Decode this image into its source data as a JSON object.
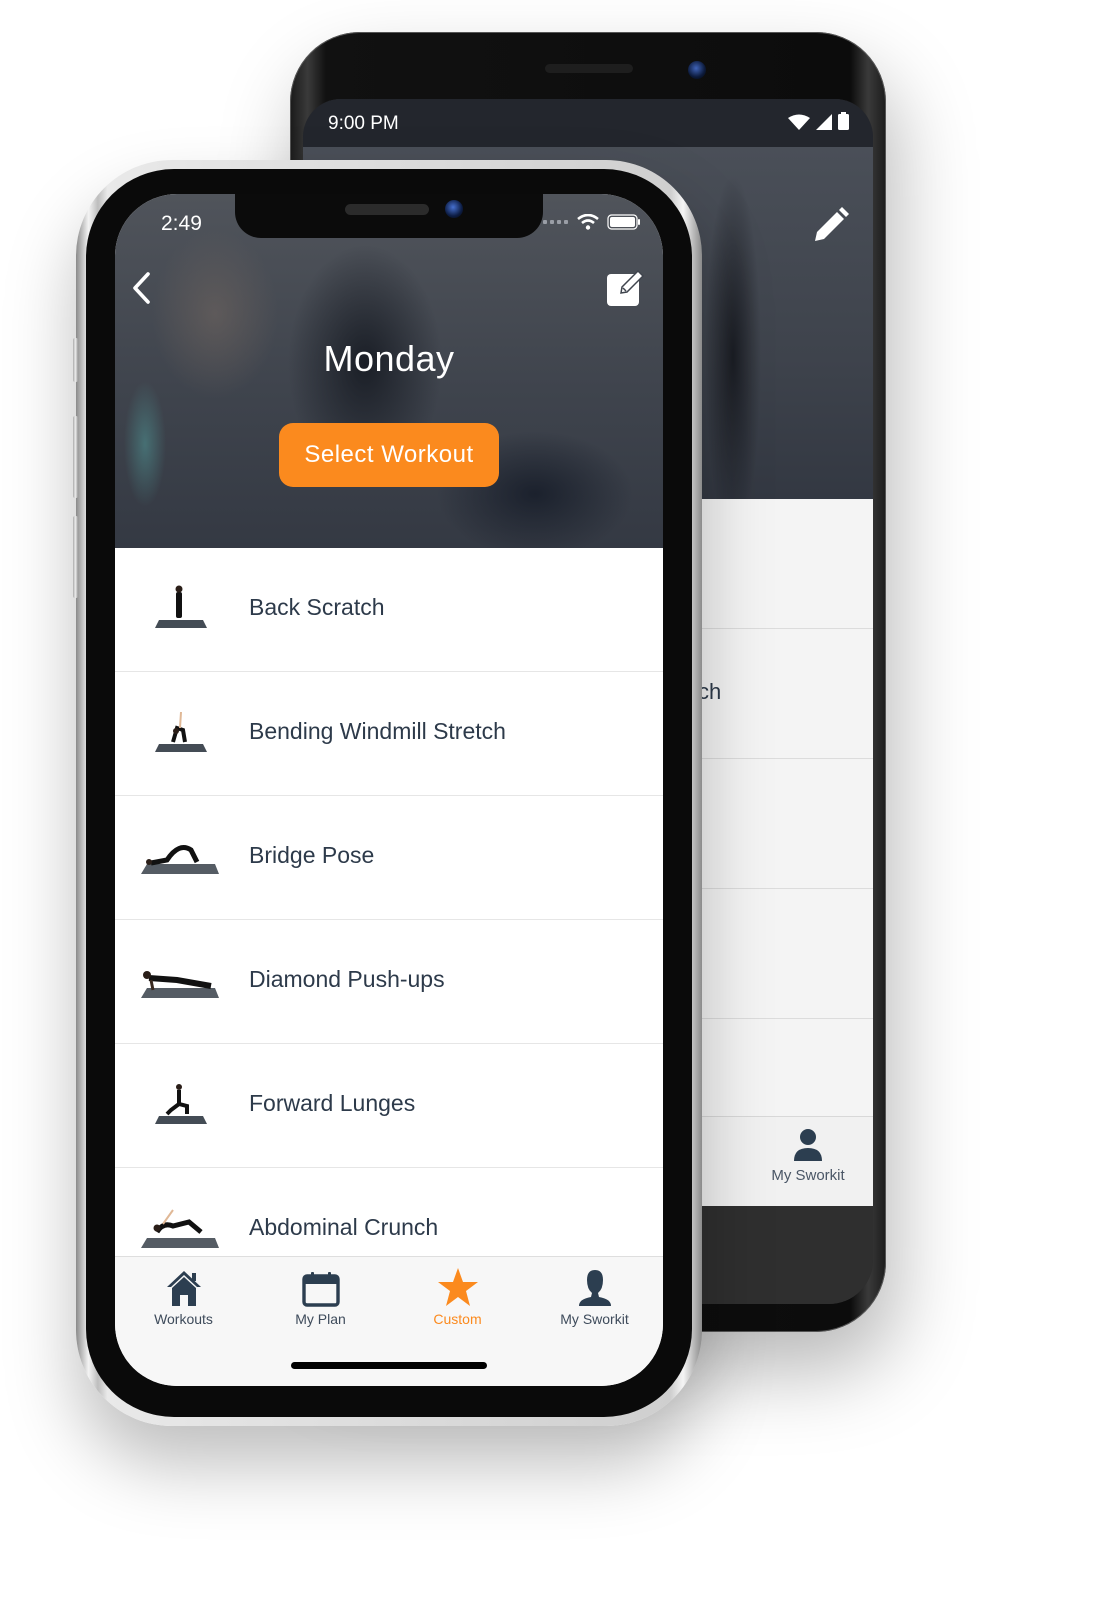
{
  "colors": {
    "accent": "#fb8a1e",
    "icon_dark": "#2c3e50",
    "text_dark": "#2d3a4a"
  },
  "back_phone": {
    "status": {
      "time": "9:00 PM",
      "icons": [
        "wifi-icon",
        "signal-icon",
        "battery-icon"
      ]
    },
    "header": {
      "edit_icon": "pencil-icon"
    },
    "list": {
      "partial_text": "ch"
    },
    "tabbar": {
      "visible_tab": {
        "label": "My Sworkit",
        "icon": "person-icon"
      }
    }
  },
  "front_phone": {
    "status": {
      "time": "2:49",
      "icons": [
        "signal-dots-icon",
        "wifi-icon",
        "battery-icon"
      ]
    },
    "header": {
      "back_icon": "chevron-left-icon",
      "edit_icon": "edit-square-icon",
      "title": "Monday",
      "select_button": "Select Workout"
    },
    "exercises": [
      {
        "name": "Back Scratch",
        "thumb": "standing-figure"
      },
      {
        "name": "Bending Windmill Stretch",
        "thumb": "bending-figure"
      },
      {
        "name": "Bridge Pose",
        "thumb": "bridge-figure"
      },
      {
        "name": "Diamond Push-ups",
        "thumb": "pushup-figure"
      },
      {
        "name": "Forward Lunges",
        "thumb": "lunge-figure"
      },
      {
        "name": "Abdominal Crunch",
        "thumb": "crunch-figure"
      }
    ],
    "tabbar": {
      "tabs": [
        {
          "label": "Workouts",
          "icon": "home-icon",
          "active": false
        },
        {
          "label": "My Plan",
          "icon": "calendar-icon",
          "active": false
        },
        {
          "label": "Custom",
          "icon": "star-icon",
          "active": true
        },
        {
          "label": "My Sworkit",
          "icon": "person-icon",
          "active": false
        }
      ]
    }
  }
}
